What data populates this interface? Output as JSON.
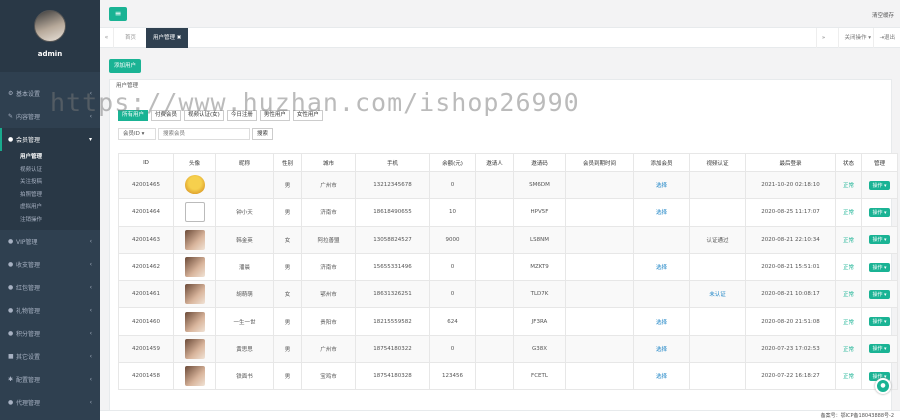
{
  "sidebar": {
    "user": "admin",
    "menu": [
      {
        "label": "基本设置",
        "icon": "gear-icon",
        "glyph": "⚙"
      },
      {
        "label": "内容管理",
        "icon": "edit-icon",
        "glyph": "✎"
      },
      {
        "label": "会员管理",
        "icon": "users-icon",
        "glyph": "●"
      }
    ],
    "member_sub": [
      "用户管理",
      "视频认证",
      "关注投稿",
      "拍照管理",
      "虚拟用户",
      "注销操作"
    ],
    "menu_after": [
      {
        "label": "VIP管理",
        "icon": "user-icon",
        "glyph": "●"
      },
      {
        "label": "收支管理",
        "icon": "user-icon",
        "glyph": "●"
      },
      {
        "label": "红包管理",
        "icon": "user-icon",
        "glyph": "●"
      },
      {
        "label": "礼物管理",
        "icon": "user-icon",
        "glyph": "●"
      },
      {
        "label": "积分管理",
        "icon": "user-icon",
        "glyph": "●"
      },
      {
        "label": "其它设置",
        "icon": "cube-icon",
        "glyph": "■"
      },
      {
        "label": "配置管理",
        "icon": "gear-icon",
        "glyph": "✱"
      },
      {
        "label": "代理管理",
        "icon": "users-icon",
        "glyph": "●"
      }
    ]
  },
  "topbar": {
    "clear_cache": "清空缓存"
  },
  "tabs": {
    "home": "首页",
    "active": "用户管理",
    "close_label": "关闭操作",
    "refresh_label": "退出"
  },
  "content": {
    "add_button": "添加用户",
    "panel_title": "用户管理",
    "filter_tabs": [
      "所有用户",
      "付费会员",
      "视频认证(女)",
      "今日注册",
      "男性用户",
      "女性用户"
    ],
    "search": {
      "select": "会员ID",
      "placeholder": "搜索会员",
      "button": "搜索"
    },
    "columns": [
      "ID",
      "头像",
      "昵称",
      "性别",
      "城市",
      "手机",
      "余额(元)",
      "邀请人",
      "邀请码",
      "会员到期时间",
      "添加会员",
      "视频认证",
      "最后登录",
      "状态",
      "管理"
    ],
    "rows": [
      {
        "id": "42001465",
        "avatar": "emoji",
        "nick": "",
        "sex": "男",
        "city": "广州市",
        "phone": "13212345678",
        "balance": "0",
        "inviter": "",
        "code": "SM6DM",
        "expire": "",
        "add": "选择",
        "video": "",
        "last": "2021-10-20 02:18:10",
        "status": "正常",
        "op": "操作"
      },
      {
        "id": "42001464",
        "avatar": "broken",
        "nick": "钟小天",
        "sex": "男",
        "city": "济南市",
        "phone": "18618490655",
        "balance": "10",
        "inviter": "",
        "code": "HPV5F",
        "expire": "",
        "add": "选择",
        "video": "",
        "last": "2020-08-25 11:17:07",
        "status": "正常",
        "op": "操作"
      },
      {
        "id": "42001463",
        "avatar": "photo",
        "nick": "韩金英",
        "sex": "女",
        "city": "阿拉善盟",
        "phone": "13058824527",
        "balance": "9000",
        "inviter": "",
        "code": "LS8NM",
        "expire": "",
        "add": "",
        "video": "认证通过",
        "last": "2020-08-21 22:10:34",
        "status": "正常",
        "op": "操作"
      },
      {
        "id": "42001462",
        "avatar": "photo",
        "nick": "潘晨",
        "sex": "男",
        "city": "济南市",
        "phone": "15655331496",
        "balance": "0",
        "inviter": "",
        "code": "MZKT9",
        "expire": "",
        "add": "选择",
        "video": "",
        "last": "2020-08-21 15:51:01",
        "status": "正常",
        "op": "操作"
      },
      {
        "id": "42001461",
        "avatar": "photo",
        "nick": "胡萌萌",
        "sex": "女",
        "city": "鄂州市",
        "phone": "18631326251",
        "balance": "0",
        "inviter": "",
        "code": "TLD7K",
        "expire": "",
        "add": "",
        "video": "未认证",
        "last": "2020-08-21 10:08:17",
        "status": "正常",
        "op": "操作"
      },
      {
        "id": "42001460",
        "avatar": "photo",
        "nick": "一生一世",
        "sex": "男",
        "city": "贵阳市",
        "phone": "18215559582",
        "balance": "624",
        "inviter": "",
        "code": "JF3RA",
        "expire": "",
        "add": "选择",
        "video": "",
        "last": "2020-08-20 21:51:08",
        "status": "正常",
        "op": "操作"
      },
      {
        "id": "42001459",
        "avatar": "photo",
        "nick": "黄思思",
        "sex": "男",
        "city": "广州市",
        "phone": "18754180322",
        "balance": "0",
        "inviter": "",
        "code": "G38X",
        "expire": "",
        "add": "选择",
        "video": "",
        "last": "2020-07-23 17:02:53",
        "status": "正常",
        "op": "操作"
      },
      {
        "id": "42001458",
        "avatar": "photo",
        "nick": "铁面书",
        "sex": "男",
        "city": "宝鸡市",
        "phone": "18754180328",
        "balance": "123456",
        "inviter": "",
        "code": "FCETL",
        "expire": "",
        "add": "选择",
        "video": "",
        "last": "2020-07-22 16:18:27",
        "status": "正常",
        "op": "操作"
      }
    ]
  },
  "watermark": "https://www.huzhan.com/ishop26990",
  "footer": {
    "icp": "备案号：鄂ICP备18043888号-2"
  },
  "colors": {
    "accent": "#1ab394",
    "sidebar": "#2f4050",
    "link": "#1c84c6"
  }
}
